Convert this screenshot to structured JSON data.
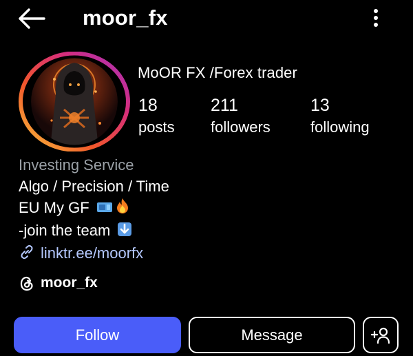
{
  "header": {
    "username": "moor_fx",
    "back_icon": "arrow-left-icon",
    "more_icon": "more-vertical-icon"
  },
  "profile": {
    "display_name": "MoOR FX /Forex trader",
    "avatar": "hooded-figure-avatar",
    "story_ring_colors": [
      "#f9c23c",
      "#f2572b",
      "#d62d7c",
      "#a332c0"
    ]
  },
  "stats": [
    {
      "value": "18",
      "label": "posts"
    },
    {
      "value": "211",
      "label": "followers"
    },
    {
      "value": "13",
      "label": "following"
    }
  ],
  "bio": {
    "category": "Investing Service",
    "line1": "Algo / Precision / Time",
    "line2": "EU My GF",
    "line2_emojis": [
      "euro-banknote-emoji",
      "fire-emoji"
    ],
    "line3": "-join the team",
    "line3_emoji": "down-arrow-emoji",
    "link": "linktr.ee/moorfx",
    "link_icon": "link-icon"
  },
  "threads": {
    "handle": "moor_fx",
    "icon": "threads-icon"
  },
  "actions": {
    "follow_label": "Follow",
    "message_label": "Message",
    "add_user_icon": "add-user-icon",
    "follow_color": "#4a5df9"
  }
}
